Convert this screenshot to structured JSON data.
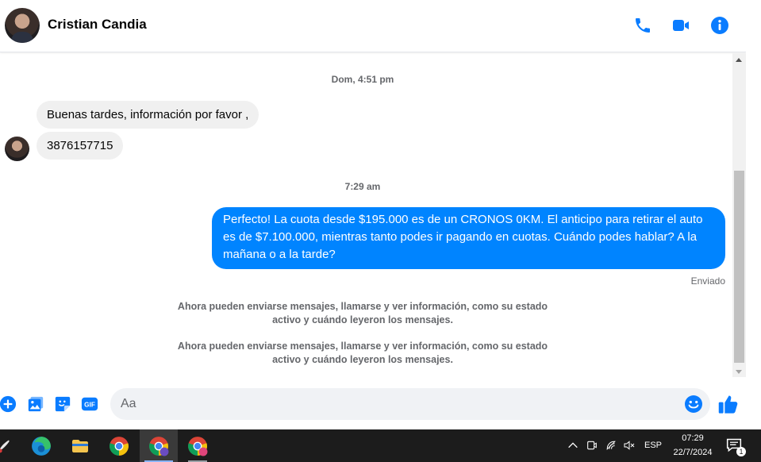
{
  "header": {
    "contact_name": "Cristian Candia"
  },
  "conversation": {
    "timestamp_1": "Dom, 4:51 pm",
    "incoming_1": "Buenas tardes, información por favor ,",
    "incoming_2": "3876157715",
    "timestamp_2": "7:29 am",
    "outgoing_1": "Perfecto! La cuota desde $195.000 es de un CRONOS 0KM. El anticipo para retirar el auto es de $7.100.000, mientras tanto podes ir pagando en cuotas. Cuándo podes hablar? A la mañana o a la tarde?",
    "outgoing_status": "Enviado",
    "system_note_1": "Ahora pueden enviarse mensajes, llamarse y ver información, como su estado activo y cuándo leyeron los mensajes.",
    "system_note_2": "Ahora pueden enviarse mensajes, llamarse y ver información, como su estado activo y cuándo leyeron los mensajes."
  },
  "composer": {
    "placeholder": "Aa",
    "gif_label": "GIF"
  },
  "taskbar": {
    "language": "ESP",
    "time": "07:29",
    "date": "22/7/2024",
    "notification_count": "1"
  },
  "colors": {
    "accent": "#0084ff",
    "incoming_bubble": "#f0f0f0",
    "taskbar": "#1c1c1c"
  }
}
